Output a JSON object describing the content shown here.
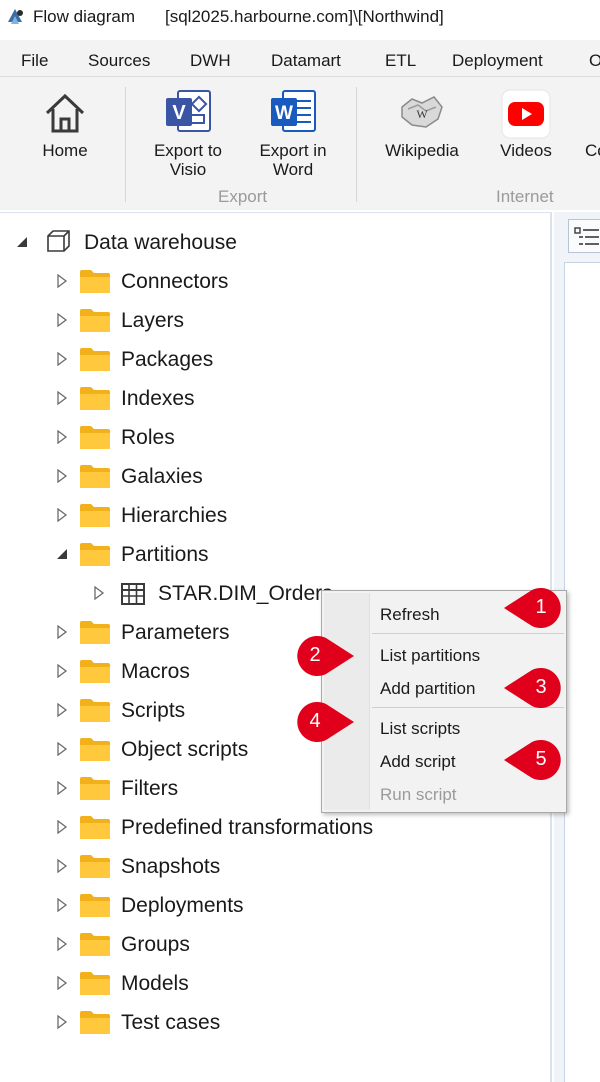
{
  "window": {
    "title": "Flow diagram",
    "connection": "[sql2025.harbourne.com]\\[Northwind]"
  },
  "menu": {
    "file": "File",
    "sources": "Sources",
    "dwh": "DWH",
    "datamart": "Datamart",
    "etl": "ETL",
    "deployment": "Deployment",
    "more": "O"
  },
  "ribbon": {
    "home": "Home",
    "export_visio_1": "Export to",
    "export_visio_2": "Visio",
    "export_word_1": "Export in",
    "export_word_2": "Word",
    "export_group": "Export",
    "wikipedia": "Wikipedia",
    "videos": "Videos",
    "more": "Co",
    "internet_group": "Internet"
  },
  "tree": {
    "root": "Data warehouse",
    "items": [
      {
        "label": "Connectors"
      },
      {
        "label": "Layers"
      },
      {
        "label": "Packages"
      },
      {
        "label": "Indexes"
      },
      {
        "label": "Roles"
      },
      {
        "label": "Galaxies"
      },
      {
        "label": "Hierarchies"
      },
      {
        "label": "Partitions"
      },
      {
        "label": "STAR.DIM_Orders"
      },
      {
        "label": "Parameters"
      },
      {
        "label": "Macros"
      },
      {
        "label": "Scripts"
      },
      {
        "label": "Object scripts"
      },
      {
        "label": "Filters"
      },
      {
        "label": "Predefined transformations"
      },
      {
        "label": "Snapshots"
      },
      {
        "label": "Deployments"
      },
      {
        "label": "Groups"
      },
      {
        "label": "Models"
      },
      {
        "label": "Test cases"
      }
    ]
  },
  "context_menu": {
    "refresh": "Refresh",
    "list_partitions": "List partitions",
    "add_partition": "Add partition",
    "list_scripts": "List scripts",
    "add_script": "Add script",
    "run_script": "Run script"
  },
  "callouts": {
    "c1": "1",
    "c2": "2",
    "c3": "3",
    "c4": "4",
    "c5": "5",
    "color": "#e0001b"
  },
  "colors": {
    "folder": "#ffc83d",
    "folder_shade": "#f2b11a",
    "word_blue": "#185abd",
    "visio_blue": "#3955a3",
    "youtube_red": "#ff0000"
  }
}
